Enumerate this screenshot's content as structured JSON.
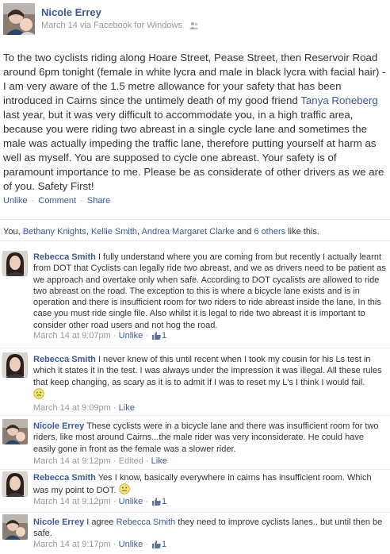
{
  "post": {
    "author": "Nicole Errey",
    "meta": "March 14 via Facebook for Windows",
    "body_parts": [
      "To the two cyclists riding along Hoare Street, Pease Street, then Reservoir Road around 6pm tonight (female in white lycra and male in black lycra with facial hair) - I am very aware of the 1.5 metre allowance for your safety that has been introduced in Cairns since the untimely death of my good friend ",
      "Tanya Roneberg",
      " last year, but it was very difficult to accommodate you, in a high traffic area, because you were riding two abreast in a single cycle lane and sometimes the male was actually impeding the traffic lane, therefore putting yourself at harm as well as myself. You are supposed to cycle one abreast. Your safety is of paramount importance to me. Please be as considerate of other drivers as we are of you. Safety First!"
    ]
  },
  "actions": {
    "unlike": "Unlike",
    "comment": "Comment",
    "share": "Share",
    "separator": "·"
  },
  "likes": {
    "prefix": "You, ",
    "names": [
      "Bethany Knights",
      "Kellie Smith",
      "Andrea Margaret Clarke"
    ],
    "joiner": ", ",
    "and": " and ",
    "others": "6 others",
    "suffix": " like this."
  },
  "colors": {
    "link": "#3b5998",
    "meta": "#999999",
    "text": "#333333"
  },
  "comments": [
    {
      "author": "Rebecca Smith",
      "text": "I fully understand where you are coming from but recently I actually learnt from DOT that Cyclists can legally ride two abreast, and we as drivers need to be patient as we approach and overtake only when safe. According to DOT cycalists are allowed to ride two abreast on the road. The exception to this is where a bicycle lane exists and is in operation and there is insufficient room for two riders to ride abreast inside the lane, In this case you must ride single file. Also whilst it is legal to ride two abreast it is important to consider other road users and not hog the road.",
      "time": "March 14 at 9:07pm",
      "action": "Unlike",
      "like_count": "1"
    },
    {
      "author": "Rebecca Smith",
      "text": "I never knew of this until recent when I took my cousin for his Ls test in which it states it in the test. I was always under the impression it was illegal. All these rules that keep changing, as scary as it is to admit if I was to reset my L's I think I would fail.",
      "time": "March 14 at 9:09pm",
      "action": "Like"
    },
    {
      "author": "Nicole Errey",
      "text": "These cyclists were in a bicycle lane and there was insufficient room for two riders, like most around Cairns...the male rider was very inconsiderate. He could have easily gone in front as the female was a slower rider.",
      "time": "March 14 at 9:12pm",
      "edited": "Edited",
      "action": "Like"
    },
    {
      "author": "Rebecca Smith",
      "text": "Yes I know, basically everywhere in cairns has insufficient room. Which was my point to DOT.",
      "time": "March 14 at 9:12pm",
      "action": "Unlike",
      "like_count": "1"
    },
    {
      "author": "Nicole Errey",
      "text_before": "I agree ",
      "mention": "Rebecca Smith",
      "text_after": " they need to improve cyclists lanes.. but until then be safe.",
      "time": "March 14 at 9:17pm",
      "action": "Unlike",
      "like_count": "1"
    }
  ],
  "icons": {
    "privacy": "friends-icon",
    "like": "thumbs-up-icon",
    "smiley": "smiley-icon"
  }
}
